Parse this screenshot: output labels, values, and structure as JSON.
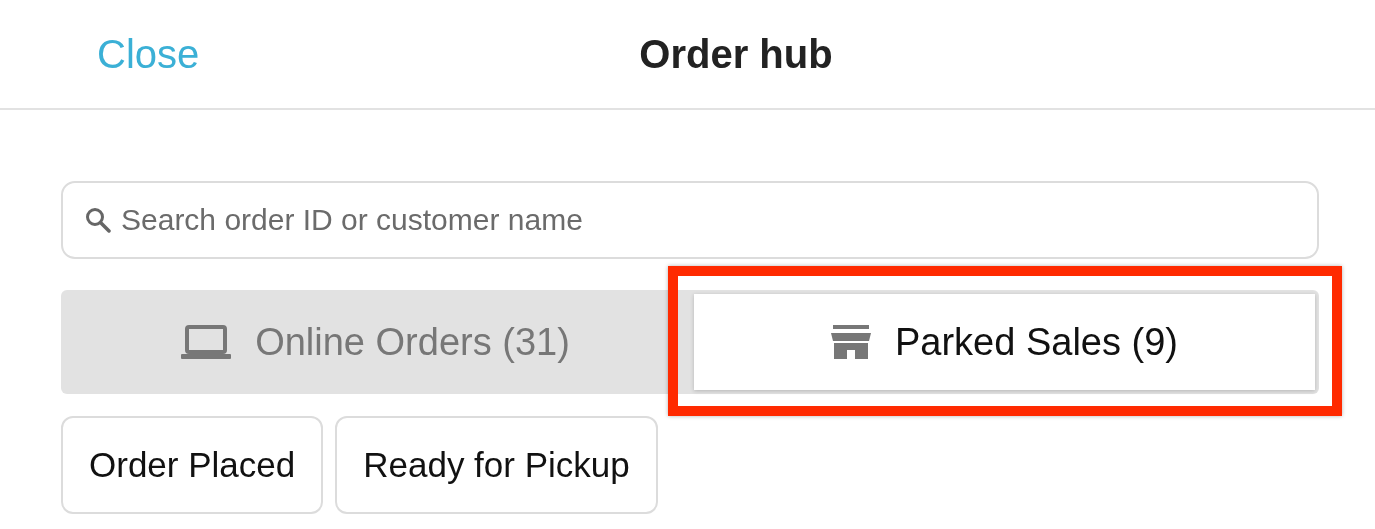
{
  "header": {
    "close": "Close",
    "title": "Order hub"
  },
  "search": {
    "placeholder": "Search order ID or customer name"
  },
  "tabs": [
    {
      "label": "Online Orders (31)",
      "kind": "laptop",
      "selected": false,
      "highlighted": false
    },
    {
      "label": "Parked Sales (9)",
      "kind": "store",
      "selected": true,
      "highlighted": true
    }
  ],
  "filters": [
    {
      "label": "Order Placed"
    },
    {
      "label": "Ready for Pickup"
    }
  ]
}
